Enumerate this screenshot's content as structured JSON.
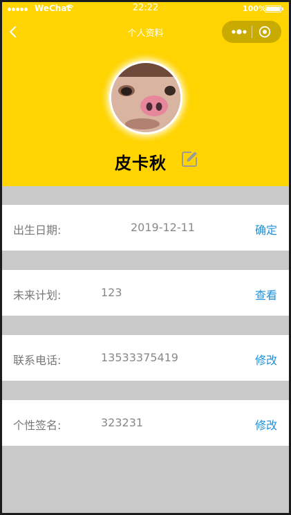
{
  "status_bar": {
    "carrier": "WeChat",
    "time": "22:22",
    "battery": "100%"
  },
  "nav": {
    "title": "个人资料"
  },
  "profile": {
    "name": "皮卡秋"
  },
  "rows": [
    {
      "label": "出生日期:",
      "value": "2019-12-11",
      "action": "确定"
    },
    {
      "label": "未来计划:",
      "value": "123",
      "action": "查看"
    },
    {
      "label": "联系电话:",
      "value": "13533375419",
      "action": "修改"
    },
    {
      "label": "个性签名:",
      "value": "323231",
      "action": "修改"
    }
  ],
  "colors": {
    "header_bg": "#ffd400",
    "page_bg": "#c9c9c9",
    "action_link": "#1e90d8"
  }
}
